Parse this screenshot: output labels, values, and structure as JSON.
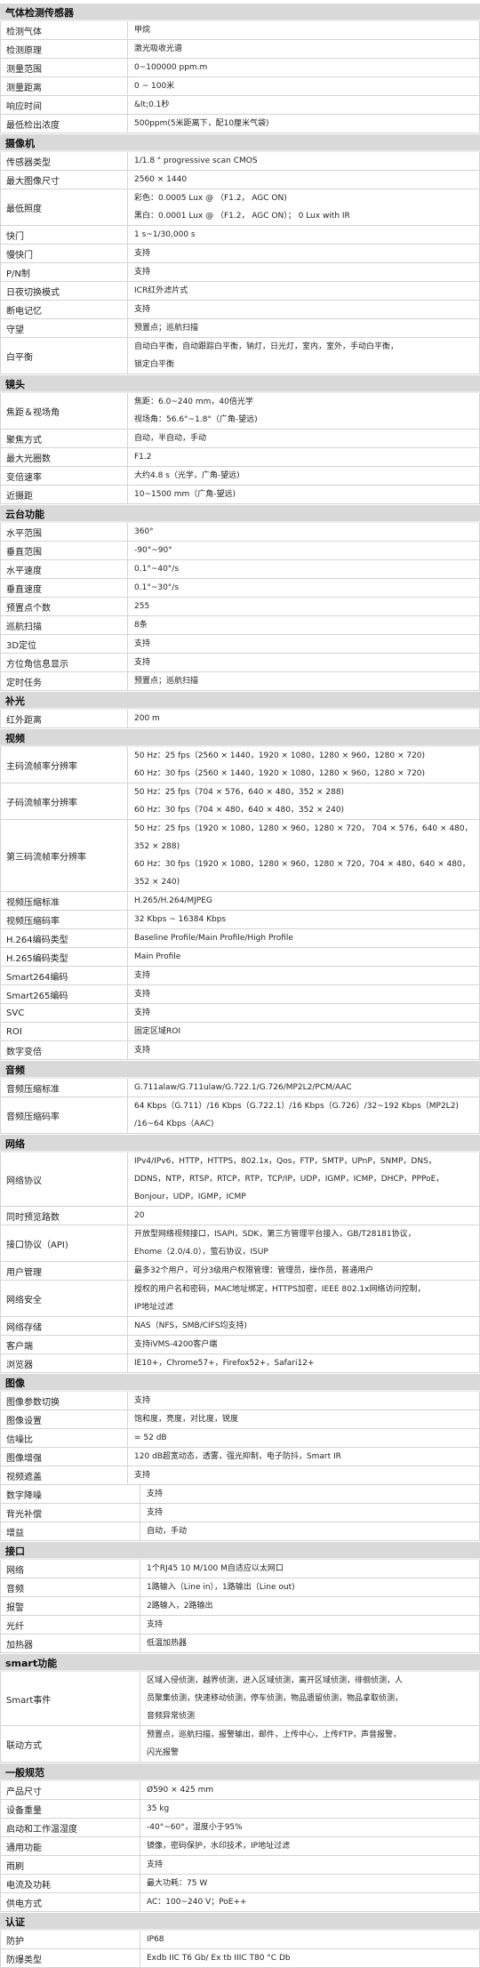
{
  "sections": [
    {
      "title": "气体检测传感器",
      "rows": [
        {
          "key": "检测气体",
          "lines": [
            "甲烷"
          ]
        },
        {
          "key": "检测原理",
          "lines": [
            "激光吸收光谱"
          ]
        },
        {
          "key": "测量范围",
          "lines": [
            "0~100000 ppm.m"
          ]
        },
        {
          "key": "测量距离",
          "lines": [
            "0 ~ 100米"
          ]
        },
        {
          "key": "响应时间",
          "lines": [
            "&lt;0.1秒"
          ]
        },
        {
          "key": "最低检出浓度",
          "lines": [
            "500ppm(5米距离下，配10厘米气袋)"
          ]
        }
      ]
    },
    {
      "title": "摄像机",
      "rows": [
        {
          "key": "传感器类型",
          "lines": [
            "1/1.8 \"  progressive scan CMOS"
          ]
        },
        {
          "key": "最大图像尺寸",
          "lines": [
            "2560 × 1440"
          ]
        },
        {
          "key": "最低照度",
          "lines": [
            "彩色：0.0005 Lux @ （F1.2， AGC ON)",
            "黑白：0.0001 Lux @ （F1.2， AGC ON）； 0 Lux with IR"
          ]
        },
        {
          "key": "快门",
          "lines": [
            "1 s~1/30,000 s"
          ]
        },
        {
          "key": "慢快门",
          "lines": [
            "支持"
          ]
        },
        {
          "key": "P/N制",
          "lines": [
            "支持"
          ]
        },
        {
          "key": "日夜切换模式",
          "lines": [
            "ICR红外滤片式"
          ]
        },
        {
          "key": "断电记忆",
          "lines": [
            "支持"
          ]
        },
        {
          "key": "守望",
          "lines": [
            "预置点；巡航扫描"
          ]
        },
        {
          "key": "白平衡",
          "lines": [
            "自动白平衡，自动跟踪白平衡，钠灯，日光灯，室内，室外，手动白平衡，",
            "锁定白平衡"
          ]
        }
      ]
    },
    {
      "title": "镜头",
      "rows": [
        {
          "key": "焦距＆视场角",
          "lines": [
            "焦距：6.0~240 mm，40倍光学",
            "视场角：56.6°~1.8°（广角-望远)"
          ]
        },
        {
          "key": "聚焦方式",
          "lines": [
            "自动，半自动，手动"
          ]
        },
        {
          "key": "最大光圈数",
          "lines": [
            "F1.2"
          ]
        },
        {
          "key": "变倍速率",
          "lines": [
            "大约4.8 s（光学，广角-望远)"
          ]
        },
        {
          "key": "近摄距",
          "lines": [
            "10~1500 mm（广角-望远)"
          ]
        }
      ]
    },
    {
      "title": "云台功能",
      "rows": [
        {
          "key": "水平范围",
          "lines": [
            "360°"
          ]
        },
        {
          "key": "垂直范围",
          "lines": [
            "-90°~90°"
          ]
        },
        {
          "key": "水平速度",
          "lines": [
            "0.1°~40°/s"
          ]
        },
        {
          "key": "垂直速度",
          "lines": [
            "0.1°~30°/s"
          ]
        },
        {
          "key": "预置点个数",
          "lines": [
            "255"
          ]
        },
        {
          "key": "巡航扫描",
          "lines": [
            "8条"
          ]
        },
        {
          "key": "3D定位",
          "lines": [
            "支持"
          ]
        },
        {
          "key": "方位角信息显示",
          "lines": [
            "支持"
          ]
        },
        {
          "key": "定时任务",
          "lines": [
            "预置点；巡航扫描"
          ]
        }
      ]
    },
    {
      "title": "补光",
      "rows": [
        {
          "key": "红外距离",
          "lines": [
            "200 m"
          ]
        }
      ]
    },
    {
      "title": "视频",
      "rows": [
        {
          "key": "主码流帧率分辨率",
          "lines": [
            "50 Hz：25 fps（2560 × 1440，1920 × 1080，1280 × 960，1280 × 720)",
            "60 Hz：30 fps（2560 × 1440，1920 × 1080，1280 × 960，1280 × 720)"
          ]
        },
        {
          "key": "子码流帧率分辨率",
          "lines": [
            "50 Hz：25 fps（704 × 576，640 × 480，352 × 288)",
            "60 Hz：30 fps（704 × 480，640 × 480，352 × 240)"
          ]
        },
        {
          "key": "第三码流帧率分辨率",
          "lines": [
            "50 Hz：25 fps（1920 × 1080，1280 × 960，1280 × 720，  704 × 576，640 × 480，",
            "352 × 288)",
            "60 Hz：30 fps（1920 × 1080，1280 × 960，1280 × 720，704 × 480，640 × 480，",
            "352 × 240)"
          ]
        },
        {
          "key": "视频压缩标准",
          "lines": [
            "H.265/H.264/MJPEG"
          ]
        },
        {
          "key": "视频压缩码率",
          "lines": [
            "32 Kbps ~ 16384 Kbps"
          ]
        },
        {
          "key": "H.264编码类型",
          "lines": [
            "Baseline Profile/Main Profile/High Profile"
          ]
        },
        {
          "key": "H.265编码类型",
          "lines": [
            "Main Profile"
          ]
        },
        {
          "key": "Smart264编码",
          "lines": [
            "支持"
          ]
        },
        {
          "key": "Smart265编码",
          "lines": [
            "支持"
          ]
        },
        {
          "key": "SVC",
          "lines": [
            "支持"
          ]
        },
        {
          "key": "ROI",
          "lines": [
            "固定区域ROI"
          ]
        },
        {
          "key": "数字变倍",
          "lines": [
            "支持"
          ]
        }
      ]
    },
    {
      "title": "音频",
      "rows": [
        {
          "key": "音频压缩标准",
          "lines": [
            "G.711alaw/G.711ulaw/G.722.1/G.726/MP2L2/PCM/AAC"
          ]
        },
        {
          "key": "音频压缩码率",
          "lines": [
            "64 Kbps（G.711）/16 Kbps（G.722.1）/16 Kbps（G.726）/32~192 Kbps（MP2L2)",
            "/16~64 Kbps（AAC)"
          ]
        }
      ]
    },
    {
      "title": "网络",
      "rows": [
        {
          "key": "网络协议",
          "lines": [
            "IPv4/IPv6，HTTP，HTTPS，802.1x，Qos，FTP，SMTP，UPnP，SNMP，DNS，",
            "DDNS，NTP，RTSP，RTCP，RTP，TCP/IP，UDP，IGMP，ICMP，DHCP，PPPoE，",
            "Bonjour，UDP，IGMP，ICMP"
          ]
        },
        {
          "key": "同时预览路数",
          "lines": [
            "20"
          ]
        },
        {
          "key": "接口协议（API)",
          "lines": [
            "开放型网络视频接口，ISAPI，SDK，第三方管理平台接入，GB/T28181协议，",
            "Ehome（2.0/4.0），萤石协议，ISUP"
          ]
        },
        {
          "key": "用户管理",
          "lines": [
            "最多32个用户，可分3级用户权限管理：管理员，操作员，普通用户"
          ]
        },
        {
          "key": "网络安全",
          "lines": [
            "授权的用户名和密码，MAC地址绑定，HTTPS加密，IEEE 802.1x网络访问控制，",
            "IP地址过滤"
          ]
        },
        {
          "key": "网络存储",
          "lines": [
            "NAS（NFS，SMB/CIFS均支持)"
          ]
        },
        {
          "key": "客户端",
          "lines": [
            "支持iVMS-4200客户端"
          ]
        },
        {
          "key": "浏览器",
          "lines": [
            "IE10+，Chrome57+，Firefox52+，Safari12+"
          ]
        }
      ]
    },
    {
      "title": "图像",
      "rows": [
        {
          "key": "图像参数切换",
          "lines": [
            "支持"
          ]
        },
        {
          "key": "图像设置",
          "lines": [
            "饱和度，亮度，对比度，锐度"
          ]
        },
        {
          "key": "信噪比",
          "lines": [
            "= 52 dB"
          ]
        },
        {
          "key": "图像增强",
          "lines": [
            "120 dB超宽动态，透雾，强光抑制，电子防抖，Smart IR"
          ]
        },
        {
          "key": "视频遮盖",
          "lines": [
            "支持"
          ]
        },
        {
          "key": "数字降噪",
          "lines": [
            "支持"
          ],
          "wide": true
        },
        {
          "key": "背光补偿",
          "lines": [
            "支持"
          ],
          "wide": true
        },
        {
          "key": "增益",
          "lines": [
            "自动，手动"
          ],
          "wide": true
        }
      ]
    },
    {
      "title": "接口",
      "wide": true,
      "rows": [
        {
          "key": "网络",
          "lines": [
            "1个RJ45 10 M/100 M自适应以太网口"
          ]
        },
        {
          "key": "音频",
          "lines": [
            "1路输入（Line in），1路输出（Line out)"
          ]
        },
        {
          "key": "报警",
          "lines": [
            "2路输入，2路输出"
          ]
        },
        {
          "key": "光纤",
          "lines": [
            "支持"
          ]
        },
        {
          "key": "加热器",
          "lines": [
            "低温加热器"
          ]
        }
      ]
    },
    {
      "title": "smart功能",
      "wide": true,
      "rows": [
        {
          "key": "Smart事件",
          "lines": [
            "区域入侵侦测，越界侦测，进入区域侦测，离开区域侦测，徘徊侦测，人",
            "员聚集侦测，快速移动侦测，停车侦测，物品遗留侦测，物品拿取侦测，",
            "音频异常侦测"
          ]
        },
        {
          "key": "联动方式",
          "lines": [
            "预置点，巡航扫描，报警输出，邮件，上传中心，上传FTP，声音报警，",
            "闪光报警"
          ]
        }
      ]
    },
    {
      "title": "一般规范",
      "wide": true,
      "rows": [
        {
          "key": "产品尺寸",
          "lines": [
            "Ø590 × 425 mm"
          ]
        },
        {
          "key": "设备重量",
          "lines": [
            "35 kg"
          ]
        },
        {
          "key": "启动和工作温湿度",
          "lines": [
            "-40°~60°，湿度小于95%"
          ]
        },
        {
          "key": "通用功能",
          "lines": [
            "镜像，密码保护，水印技术，IP地址过滤"
          ]
        },
        {
          "key": "雨刷",
          "lines": [
            "支持"
          ]
        },
        {
          "key": "电流及功耗",
          "lines": [
            "最大功耗：75 W"
          ]
        },
        {
          "key": "供电方式",
          "lines": [
            "AC：100~240 V；PoE++"
          ]
        }
      ]
    },
    {
      "title": "认证",
      "wide": true,
      "rows": [
        {
          "key": "防护",
          "lines": [
            "IP68"
          ]
        },
        {
          "key": "防爆类型",
          "lines": [
            "Exdb IIC T6 Gb/ Ex tb IIIC T80 °C Db"
          ]
        }
      ]
    }
  ]
}
